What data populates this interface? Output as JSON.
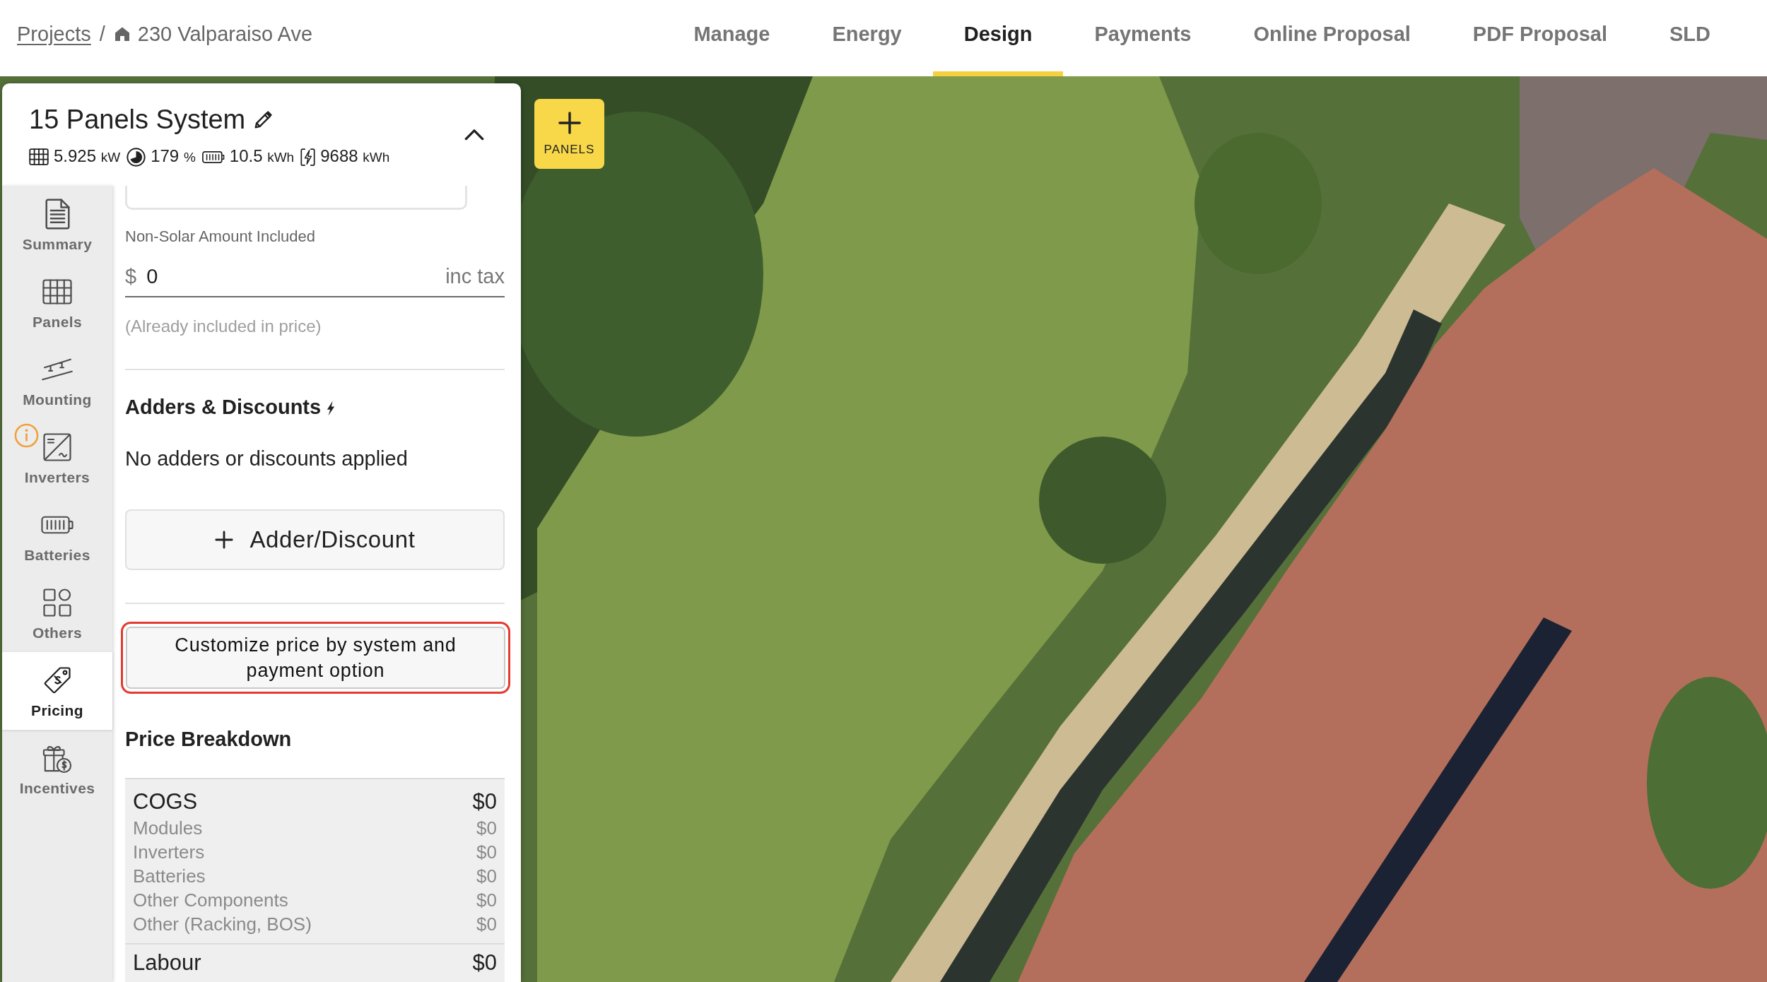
{
  "breadcrumb": {
    "separator": "/",
    "items": [
      {
        "label": "Projects",
        "kind": "link"
      },
      {
        "label": "230 Valparaiso Ave",
        "kind": "project"
      }
    ]
  },
  "nav": {
    "tabs": [
      {
        "label": "Manage",
        "selected": false
      },
      {
        "label": "Energy",
        "selected": false
      },
      {
        "label": "Design",
        "selected": true
      },
      {
        "label": "Payments",
        "selected": false
      },
      {
        "label": "Online Proposal",
        "selected": false
      },
      {
        "label": "PDF Proposal",
        "selected": false
      },
      {
        "label": "SLD",
        "selected": false
      }
    ]
  },
  "system": {
    "title": "15 Panels System",
    "expanded": true,
    "stats": [
      {
        "kind": "panels",
        "value": "5.925",
        "unit": "kW"
      },
      {
        "kind": "offset",
        "value": "179",
        "unit": "%"
      },
      {
        "kind": "battery",
        "value": "10.5",
        "unit": "kWh"
      },
      {
        "kind": "production",
        "value": "9688",
        "unit": "kWh"
      }
    ]
  },
  "sidebar": {
    "items": [
      {
        "label": "Summary",
        "kind": "summary",
        "selected": false,
        "info_badge": false
      },
      {
        "label": "Panels",
        "kind": "panels",
        "selected": false,
        "info_badge": false
      },
      {
        "label": "Mounting",
        "kind": "mounting",
        "selected": false,
        "info_badge": false
      },
      {
        "label": "Inverters",
        "kind": "inverters",
        "selected": false,
        "info_badge": true
      },
      {
        "label": "Batteries",
        "kind": "batteries",
        "selected": false,
        "info_badge": false
      },
      {
        "label": "Others",
        "kind": "others",
        "selected": false,
        "info_badge": false
      },
      {
        "label": "Pricing",
        "kind": "pricing",
        "selected": true,
        "info_badge": false
      },
      {
        "label": "Incentives",
        "kind": "incentives",
        "selected": false,
        "info_badge": false
      }
    ]
  },
  "pricing": {
    "non_solar": {
      "label": "Non-Solar Amount Included",
      "prefix": "$",
      "value": "0",
      "suffix": "inc tax",
      "helper": "(Already included in price)"
    },
    "adders": {
      "title": "Adders & Discounts",
      "empty_text": "No adders or discounts applied",
      "add_button": "Adder/Discount"
    },
    "customize_button": {
      "label": "Customize price by system and payment option",
      "highlighted": true
    },
    "breakdown": {
      "title": "Price Breakdown",
      "groups": [
        {
          "label": "COGS",
          "value": "$0",
          "items": [
            {
              "label": "Modules",
              "value": "$0"
            },
            {
              "label": "Inverters",
              "value": "$0"
            },
            {
              "label": "Batteries",
              "value": "$0"
            },
            {
              "label": "Other Components",
              "value": "$0"
            },
            {
              "label": "Other (Racking, BOS)",
              "value": "$0"
            }
          ]
        },
        {
          "label": "Labour",
          "value": "$0"
        }
      ]
    }
  },
  "map": {
    "add_panels_button": {
      "label": "PANELS"
    }
  }
}
